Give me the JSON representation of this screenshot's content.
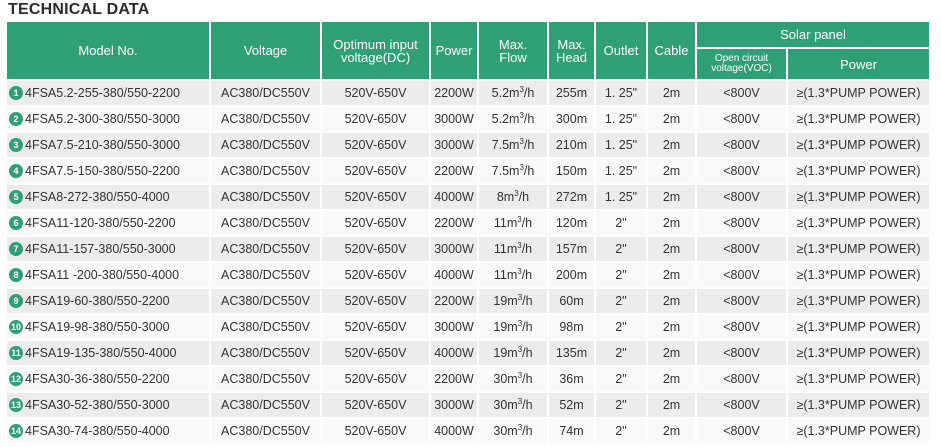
{
  "title": "TECHNICAL DATA",
  "header": {
    "model": "Model No.",
    "voltage": "Voltage",
    "opt_input_line1": "Optimum input",
    "opt_input_line2": "voltage(DC)",
    "power": "Power",
    "max_flow_line1": "Max.",
    "max_flow_line2": "Flow",
    "max_head_line1": "Max.",
    "max_head_line2": "Head",
    "outlet": "Outlet",
    "cable": "Cable",
    "solar_panel": "Solar panel",
    "voc_line1": "Open circuit",
    "voc_line2": "voltage(VOC)",
    "panel_power": "Power"
  },
  "flow_unit_sup": "3",
  "rows": [
    {
      "no": "1",
      "model": "4FSA5.2-255-380/550-2200",
      "voltage": "AC380/DC550V",
      "input": "520V-650V",
      "power": "2200W",
      "flow": "5.2m",
      "flow_suffix": "/h",
      "head": "255m",
      "outlet": "1. 25\"",
      "cable": "2m",
      "voc": "<800V",
      "panel": "≥(1.3*PUMP POWER)"
    },
    {
      "no": "2",
      "model": "4FSA5.2-300-380/550-3000",
      "voltage": "AC380/DC550V",
      "input": "520V-650V",
      "power": "3000W",
      "flow": "5.2m",
      "flow_suffix": "/h",
      "head": "300m",
      "outlet": "1. 25\"",
      "cable": "2m",
      "voc": "<800V",
      "panel": "≥(1.3*PUMP POWER)"
    },
    {
      "no": "3",
      "model": "4FSA7.5-210-380/550-3000",
      "voltage": "AC380/DC550V",
      "input": "520V-650V",
      "power": "3000W",
      "flow": "7.5m",
      "flow_suffix": "/h",
      "head": "210m",
      "outlet": "1. 25\"",
      "cable": "2m",
      "voc": "<800V",
      "panel": "≥(1.3*PUMP POWER)"
    },
    {
      "no": "4",
      "model": "4FSA7.5-150-380/550-2200",
      "voltage": "AC380/DC550V",
      "input": "520V-650V",
      "power": "2200W",
      "flow": "7.5m",
      "flow_suffix": "/h",
      "head": "150m",
      "outlet": "1. 25\"",
      "cable": "2m",
      "voc": "<800V",
      "panel": "≥(1.3*PUMP POWER)"
    },
    {
      "no": "5",
      "model": "4FSA8-272-380/550-4000",
      "voltage": "AC380/DC550V",
      "input": "520V-650V",
      "power": "4000W",
      "flow": "8m",
      "flow_suffix": "/h",
      "head": "272m",
      "outlet": "1. 25\"",
      "cable": "2m",
      "voc": "<800V",
      "panel": "≥(1.3*PUMP POWER)"
    },
    {
      "no": "6",
      "model": "4FSA11-120-380/550-2200",
      "voltage": "AC380/DC550V",
      "input": "520V-650V",
      "power": "2200W",
      "flow": "11m",
      "flow_suffix": "/h",
      "head": "120m",
      "outlet": "2\"",
      "cable": "2m",
      "voc": "<800V",
      "panel": "≥(1.3*PUMP POWER)"
    },
    {
      "no": "7",
      "model": "4FSA11-157-380/550-3000",
      "voltage": "AC380/DC550V",
      "input": "520V-650V",
      "power": "3000W",
      "flow": "11m",
      "flow_suffix": "/h",
      "head": "157m",
      "outlet": "2\"",
      "cable": "2m",
      "voc": "<800V",
      "panel": "≥(1.3*PUMP POWER)"
    },
    {
      "no": "8",
      "model": "4FSA11 -200-380/550-4000",
      "voltage": "AC380/DC550V",
      "input": "520V-650V",
      "power": "4000W",
      "flow": "11m",
      "flow_suffix": "/h",
      "head": "200m",
      "outlet": "2\"",
      "cable": "2m",
      "voc": "<800V",
      "panel": "≥(1.3*PUMP POWER)"
    },
    {
      "no": "9",
      "model": "4FSA19-60-380/550-2200",
      "voltage": "AC380/DC550V",
      "input": "520V-650V",
      "power": "2200W",
      "flow": "19m",
      "flow_suffix": "/h",
      "head": "60m",
      "outlet": "2\"",
      "cable": "2m",
      "voc": "<800V",
      "panel": "≥(1.3*PUMP POWER)"
    },
    {
      "no": "10",
      "model": "4FSA19-98-380/550-3000",
      "voltage": "AC380/DC550V",
      "input": "520V-650V",
      "power": "3000W",
      "flow": "19m",
      "flow_suffix": "/h",
      "head": "98m",
      "outlet": "2\"",
      "cable": "2m",
      "voc": "<800V",
      "panel": "≥(1.3*PUMP POWER)"
    },
    {
      "no": "11",
      "model": "4FSA19-135-380/550-4000",
      "voltage": "AC380/DC550V",
      "input": "520V-650V",
      "power": "4000W",
      "flow": "19m",
      "flow_suffix": "/h",
      "head": "135m",
      "outlet": "2\"",
      "cable": "2m",
      "voc": "<800V",
      "panel": "≥(1.3*PUMP POWER)"
    },
    {
      "no": "12",
      "model": "4FSA30-36-380/550-2200",
      "voltage": "AC380/DC550V",
      "input": "520V-650V",
      "power": "2200W",
      "flow": "30m",
      "flow_suffix": "/h",
      "head": "36m",
      "outlet": "2\"",
      "cable": "2m",
      "voc": "<800V",
      "panel": "≥(1.3*PUMP POWER)"
    },
    {
      "no": "13",
      "model": "4FSA30-52-380/550-3000",
      "voltage": "AC380/DC550V",
      "input": "520V-650V",
      "power": "3000W",
      "flow": "30m",
      "flow_suffix": "/h",
      "head": "52m",
      "outlet": "2\"",
      "cable": "2m",
      "voc": "<800V",
      "panel": "≥(1.3*PUMP POWER)"
    },
    {
      "no": "14",
      "model": "4FSA30-74-380/550-4000",
      "voltage": "AC380/DC550V",
      "input": "520V-650V",
      "power": "4000W",
      "flow": "30m",
      "flow_suffix": "/h",
      "head": "74m",
      "outlet": "2\"",
      "cable": "2m",
      "voc": "<800V",
      "panel": "≥(1.3*PUMP POWER)"
    }
  ]
}
